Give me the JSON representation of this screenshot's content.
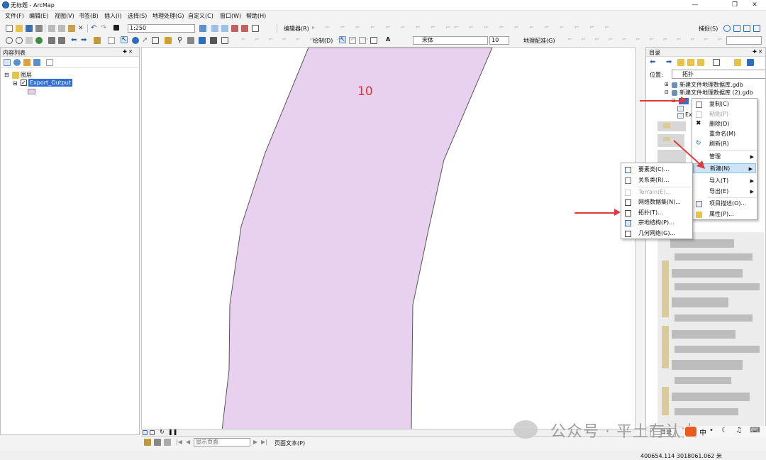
{
  "window": {
    "title": "无标题 - ArcMap"
  },
  "menu": [
    "文件(F)",
    "编辑(E)",
    "视图(V)",
    "书签(B)",
    "插入(I)",
    "选择(S)",
    "地理处理(G)",
    "自定义(C)",
    "窗口(W)",
    "帮助(H)"
  ],
  "toolbar": {
    "scale": "1:250",
    "editor_label": "编辑器(R)",
    "snapping_label": "捕捉(S)",
    "draw_label": "绘制(D)",
    "font_name": "宋体",
    "font_size": "10",
    "georef_label": "地理配准(G)"
  },
  "toc": {
    "title": "内容列表",
    "pin": "✚ ✕",
    "layers_group": "图层",
    "layer_name": "Export_Output"
  },
  "map": {
    "feature_label": "10",
    "fill_color": "#e8d1ef",
    "label_color": "#e03030"
  },
  "layout_bar": {
    "page_box": "显示页面",
    "text_menu": "页面文本(P)"
  },
  "catalog": {
    "title": "目录",
    "pin": "✚ ✕",
    "location_label": "位置:",
    "location_value": "拓扑",
    "tree": [
      "新建文件地理数据库.gdb",
      "新建文件地理数据库 (2).gdb"
    ],
    "tab_label": "目录"
  },
  "context_menu": {
    "items": [
      {
        "label": "复制(C)",
        "enabled": true
      },
      {
        "label": "粘贴(P)",
        "enabled": false
      },
      {
        "label": "删除(D)",
        "enabled": true
      },
      {
        "label": "重命名(M)",
        "enabled": true
      },
      {
        "label": "刷新(R)",
        "enabled": true
      },
      {
        "label": "管理",
        "enabled": true
      },
      {
        "label": "新建(N)",
        "enabled": true
      },
      {
        "label": "导入(T)",
        "enabled": true
      },
      {
        "label": "导出(E)",
        "enabled": true
      },
      {
        "label": "项目描述(O)...",
        "enabled": true
      },
      {
        "label": "属性(P)...",
        "enabled": true
      }
    ]
  },
  "submenu": {
    "items": [
      {
        "label": "要素类(C)...",
        "enabled": true
      },
      {
        "label": "关系类(R)...",
        "enabled": true
      },
      {
        "label": "Terrain(E)...",
        "enabled": false
      },
      {
        "label": "网络数据集(N)...",
        "enabled": true
      },
      {
        "label": "拓扑(T)...",
        "enabled": true
      },
      {
        "label": "宗地结构(P)...",
        "enabled": true
      },
      {
        "label": "几何网络(G)...",
        "enabled": true
      }
    ]
  },
  "statusbar": {
    "coords": "400654.114  3018061.062 米"
  },
  "watermark": "公众号 · 平土有认大"
}
